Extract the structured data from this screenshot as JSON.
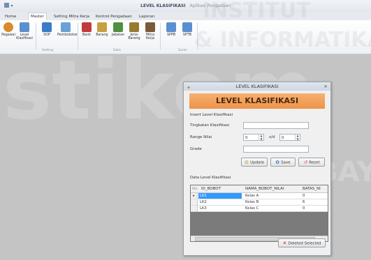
{
  "app": {
    "menu_glyph": "▾",
    "window_title": "LEVEL KLASIFIKASI",
    "window_subtitle": "Aplikasi Pengadaan"
  },
  "tabs": [
    {
      "label": "Home"
    },
    {
      "label": "Master"
    },
    {
      "label": "Setting Mitra Kerja"
    },
    {
      "label": "Kontrol Pengadaan"
    },
    {
      "label": "Laporan"
    }
  ],
  "ribbon": {
    "buttons": [
      {
        "label": "Pegawai",
        "color": "#d98a2b"
      },
      {
        "label": "Level Klasifikasi",
        "color": "#5a8fd0"
      },
      {
        "label": "SOP",
        "color": "#3a7bc8"
      },
      {
        "label": "Pembobotan",
        "color": "#6aa0d8"
      },
      {
        "label": "Bank",
        "color": "#c23b3b"
      },
      {
        "label": "Barang",
        "color": "#c8a040"
      },
      {
        "label": "Jabatan",
        "color": "#4f8f3f"
      },
      {
        "label": "Jenis Barang",
        "color": "#9a7a30"
      },
      {
        "label": "Mitra Kerja",
        "color": "#7a5a3a"
      },
      {
        "label": "SPPB",
        "color": "#5a8fd0"
      },
      {
        "label": "SPTB",
        "color": "#5a8fd0"
      }
    ],
    "groups": [
      {
        "label": "Setting"
      },
      {
        "label": "Data"
      },
      {
        "label": "Surat"
      }
    ]
  },
  "watermark": {
    "line1": "stikom",
    "line2": "INSTITUT",
    "line3": "& INFORMATIKA",
    "line4": "SURABAYA"
  },
  "dialog": {
    "title": "LEVEL KLASIFIKASI",
    "header": "LEVEL KLASIFIKASI",
    "close_glyph": "×",
    "insert_section": "Insert Level Klasifikasi",
    "labels": {
      "tingkatan": "Tingkatan Klasifikasi",
      "range": "Range Nilai",
      "sd": "s/d",
      "grade": "Grade"
    },
    "fields": {
      "tingkatan": "",
      "range_from": "0",
      "range_to": "0",
      "grade": ""
    },
    "buttons": {
      "update": "Update",
      "save": "Save",
      "reset": "Reset",
      "delete": "Deleted Selected"
    },
    "data_section": "Data Level Klasifikasi",
    "table": {
      "columns": [
        "No",
        "ID_BOBOT",
        "NAMA_BOBOT_NILAI",
        "BATAS_NI"
      ],
      "rows": [
        {
          "marker": "▸",
          "id": "LK1",
          "nama": "Kelas A",
          "batas": "0"
        },
        {
          "marker": "",
          "id": "LK2",
          "nama": "Kelas B",
          "batas": "6"
        },
        {
          "marker": "",
          "id": "LK3",
          "nama": "Kelas C",
          "batas": "0"
        }
      ]
    }
  }
}
